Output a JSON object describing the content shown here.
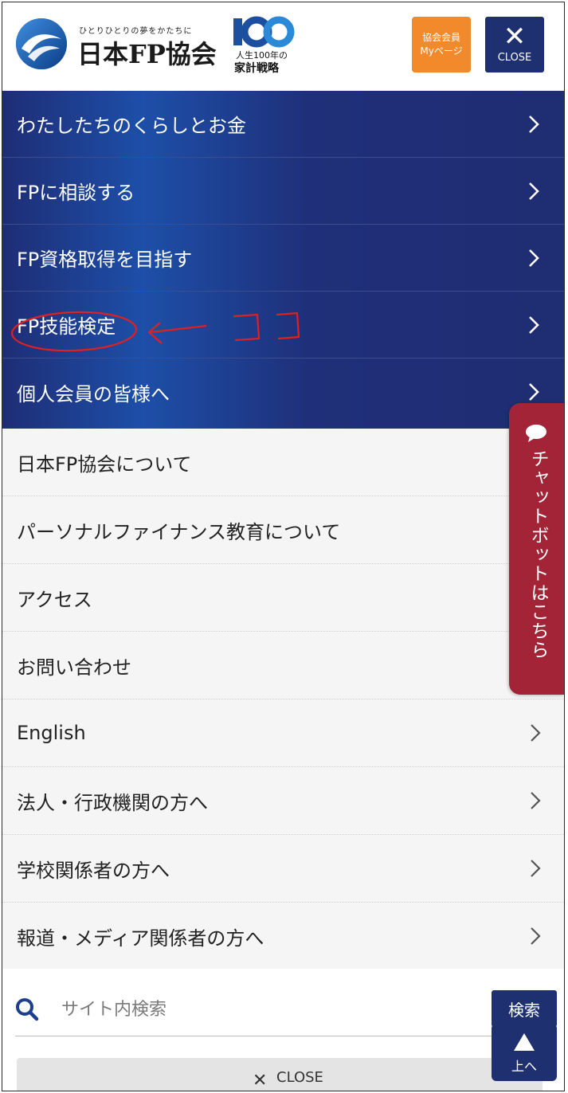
{
  "header": {
    "org_sub": "ひとりひとりの夢をかたちに",
    "org_name": "日本FP協会",
    "badge_line1": "人生100年の",
    "badge_line2": "家計戦略",
    "member_btn": [
      "協会会員",
      "Myページ"
    ],
    "close_label": "CLOSE"
  },
  "primary_nav": [
    {
      "label": "わたしたちのくらしとお金"
    },
    {
      "label": "FPに相談する"
    },
    {
      "label": "FP資格取得を目指す"
    },
    {
      "label": "FP技能検定"
    },
    {
      "label": "個人会員の皆様へ"
    }
  ],
  "secondary_nav": [
    {
      "label": "日本FP協会について"
    },
    {
      "label": "パーソナルファイナンス教育について"
    },
    {
      "label": "アクセス"
    },
    {
      "label": "お問い合わせ"
    },
    {
      "label": "English"
    },
    {
      "label": "法人・行政機関の方へ"
    },
    {
      "label": "学校関係者の方へ"
    },
    {
      "label": "報道・メディア関係者の方へ"
    }
  ],
  "search": {
    "placeholder": "サイト内検索",
    "button": "検索"
  },
  "bottom_close": {
    "label": "CLOSE"
  },
  "chatbot": {
    "label": "チャットボットはこちら"
  },
  "to_top": {
    "label": "上へ"
  },
  "colors": {
    "navy": "#1e3070",
    "orange": "#f28a2c",
    "chatbot_red": "#a22436",
    "annotation_red": "#e02020"
  }
}
